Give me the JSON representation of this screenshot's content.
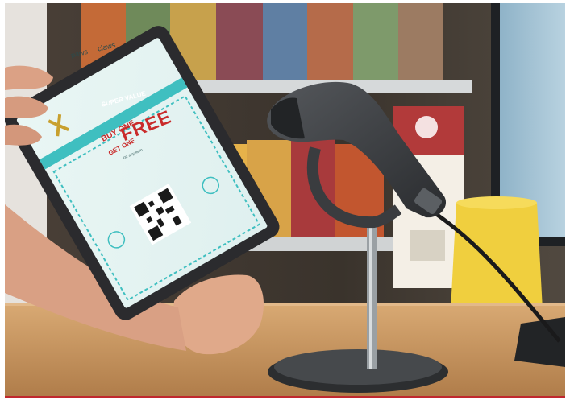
{
  "image": {
    "alt": "Hand holding a tablet showing a mobile coupon with a QR code in front of a handheld barcode scanner on a stand at a store counter",
    "colors": {
      "counter": "#c49563",
      "shelf_background": "#3a332c",
      "coupon_teal": "#3fbfc0",
      "tablet_body": "#2b2b2e",
      "scanner_body": "#3b3d40",
      "cup_yellow": "#f0cf3e"
    }
  },
  "coupon": {
    "brand_left": "paws",
    "brand_right": "claws",
    "banner": "SUPER VALUE",
    "headline_top": "BUY ONE",
    "headline_bottom": "GET ONE",
    "offer": "FREE",
    "fine_print": "on any item"
  },
  "icons": {
    "qr": "qr-code-icon",
    "logo": "dog-logo-icon"
  }
}
